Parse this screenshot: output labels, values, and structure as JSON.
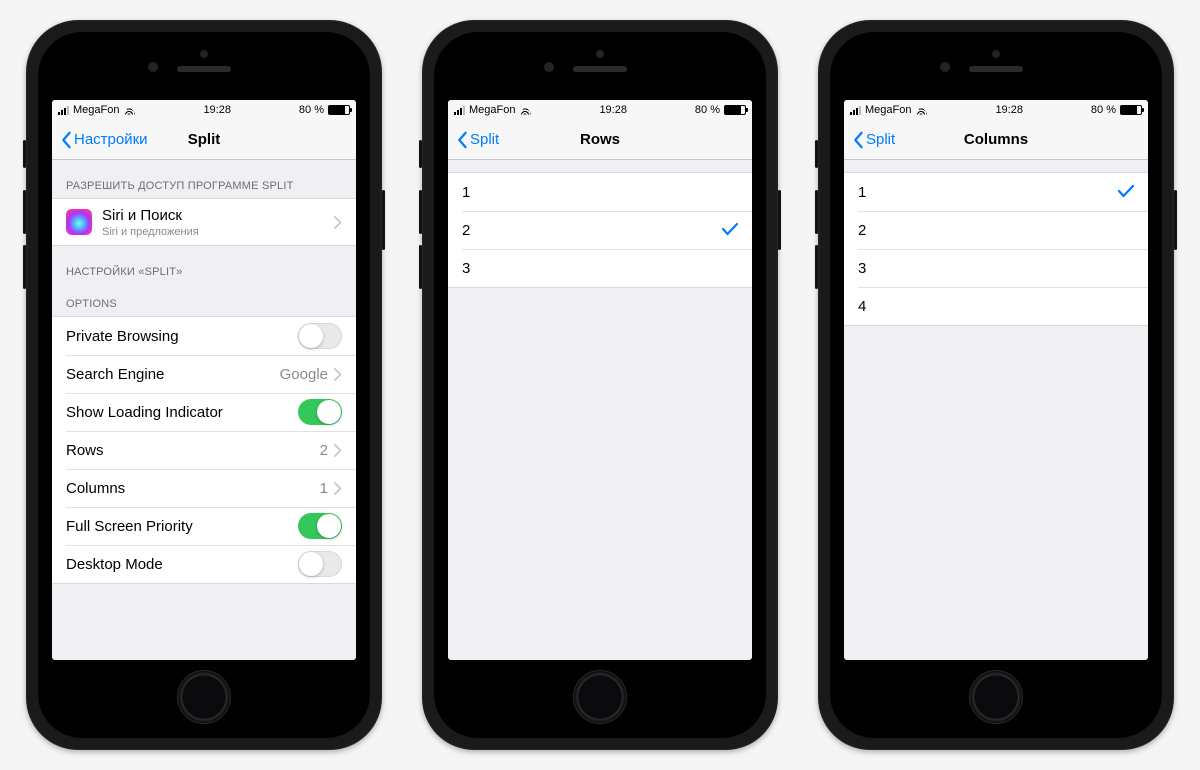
{
  "status": {
    "carrier": "MegaFon",
    "time": "19:28",
    "battery": "80 %"
  },
  "screens": [
    {
      "back": "Настройки",
      "title": "Split",
      "section1_header": "РАЗРЕШИТЬ ДОСТУП ПРОГРАММЕ SPLIT",
      "siri": {
        "title": "Siri и Поиск",
        "sub": "Siri и предложения"
      },
      "section2_header": "НАСТРОЙКИ «SPLIT»",
      "options_header": "OPTIONS",
      "rows": {
        "private_browsing": "Private Browsing",
        "search_engine": "Search Engine",
        "search_engine_val": "Google",
        "loading": "Show Loading Indicator",
        "rows_label": "Rows",
        "rows_val": "2",
        "cols_label": "Columns",
        "cols_val": "1",
        "fullscreen": "Full Screen Priority",
        "desktop": "Desktop Mode"
      }
    },
    {
      "back": "Split",
      "title": "Rows",
      "items": [
        "1",
        "2",
        "3"
      ],
      "selected": 1
    },
    {
      "back": "Split",
      "title": "Columns",
      "items": [
        "1",
        "2",
        "3",
        "4"
      ],
      "selected": 0
    }
  ]
}
